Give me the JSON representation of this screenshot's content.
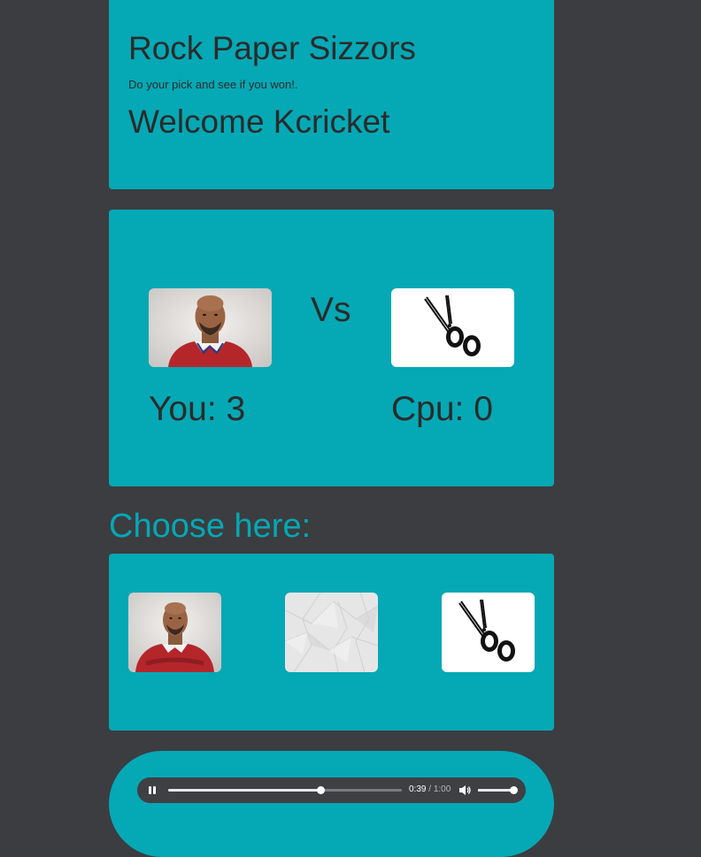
{
  "header": {
    "title": "Rock Paper Sizzors",
    "subtitle": "Do your pick and see if you won!.",
    "welcome": "Welcome Kcricket"
  },
  "battle": {
    "player_pick": "rock",
    "cpu_pick": "scissors",
    "vs_label": "Vs",
    "score_you_label": "You: 3",
    "score_cpu_label": "Cpu: 0"
  },
  "choose": {
    "heading": "Choose here:",
    "options": [
      {
        "id": "rock",
        "icon": "rock-photo-icon"
      },
      {
        "id": "paper",
        "icon": "crumpled-paper-icon"
      },
      {
        "id": "scissors",
        "icon": "scissors-icon"
      }
    ]
  },
  "audio": {
    "current_time": "0:39",
    "separator": "/",
    "duration": "1:00",
    "progress": 0.65,
    "volume": 1.0,
    "state": "playing",
    "play_icon": "pause-icon",
    "volume_icon": "speaker-icon"
  },
  "colors": {
    "page_bg": "#3b3d40",
    "accent": "#05a8b5",
    "text_dark": "#2b2b2b",
    "player_bg": "#3f4044"
  }
}
